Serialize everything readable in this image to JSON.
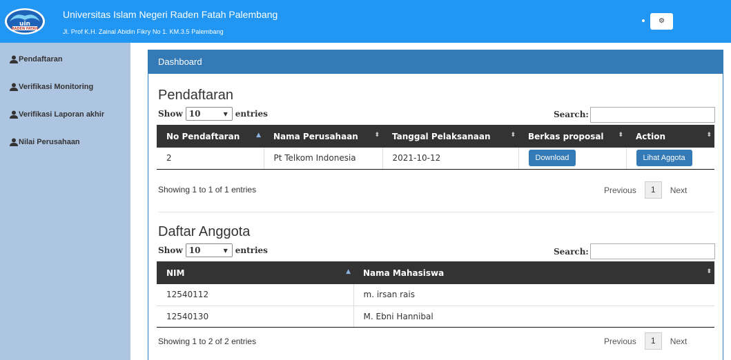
{
  "header": {
    "university": "Universitas Islam Negeri Raden Fatah Palembang",
    "address": "Jl. Prof K.H. Zainal Abidin Fikry No 1. KM.3.5 Palembang",
    "logo_text": "uin",
    "logo_subtext": "RADEN FATAH",
    "settings_icon": "gear-icon",
    "brand_color": "#2196f3"
  },
  "sidebar": {
    "items": [
      {
        "label": "Pendaftaran",
        "icon": "user-icon"
      },
      {
        "label": "Verifikasi Monitoring",
        "icon": "user-icon"
      },
      {
        "label": "Verifikasi Laporan akhir",
        "icon": "user-icon"
      },
      {
        "label": "Nilai Perusahaan",
        "icon": "user-icon"
      }
    ]
  },
  "panel": {
    "title": "Dashboard"
  },
  "pendaftaran": {
    "title": "Pendaftaran",
    "show": "Show",
    "entries_value": "10",
    "entries": "entries",
    "search": "Search:",
    "columns": [
      "No Pendaftaran",
      "Nama Perusahaan",
      "Tanggal Pelaksanaan",
      "Berkas proposal",
      "Action"
    ],
    "rows": [
      {
        "no": "2",
        "perusahaan": "Pt Telkom Indonesia",
        "tanggal": "2021-10-12",
        "berkas": "Download",
        "action": "Lihat Aggota"
      }
    ],
    "info": "Showing 1 to 1 of 1 entries",
    "prev": "Previous",
    "page": "1",
    "next": "Next"
  },
  "anggota": {
    "title": "Daftar Anggota",
    "show": "Show",
    "entries_value": "10",
    "entries": "entries",
    "search": "Search:",
    "columns": [
      "NIM",
      "Nama Mahasiswa"
    ],
    "rows": [
      {
        "nim": "12540112",
        "nama": "m. irsan rais"
      },
      {
        "nim": "12540130",
        "nama": "M. Ebni Hannibal"
      }
    ],
    "info": "Showing 1 to 2 of 2 entries",
    "prev": "Previous",
    "page": "1",
    "next": "Next"
  }
}
